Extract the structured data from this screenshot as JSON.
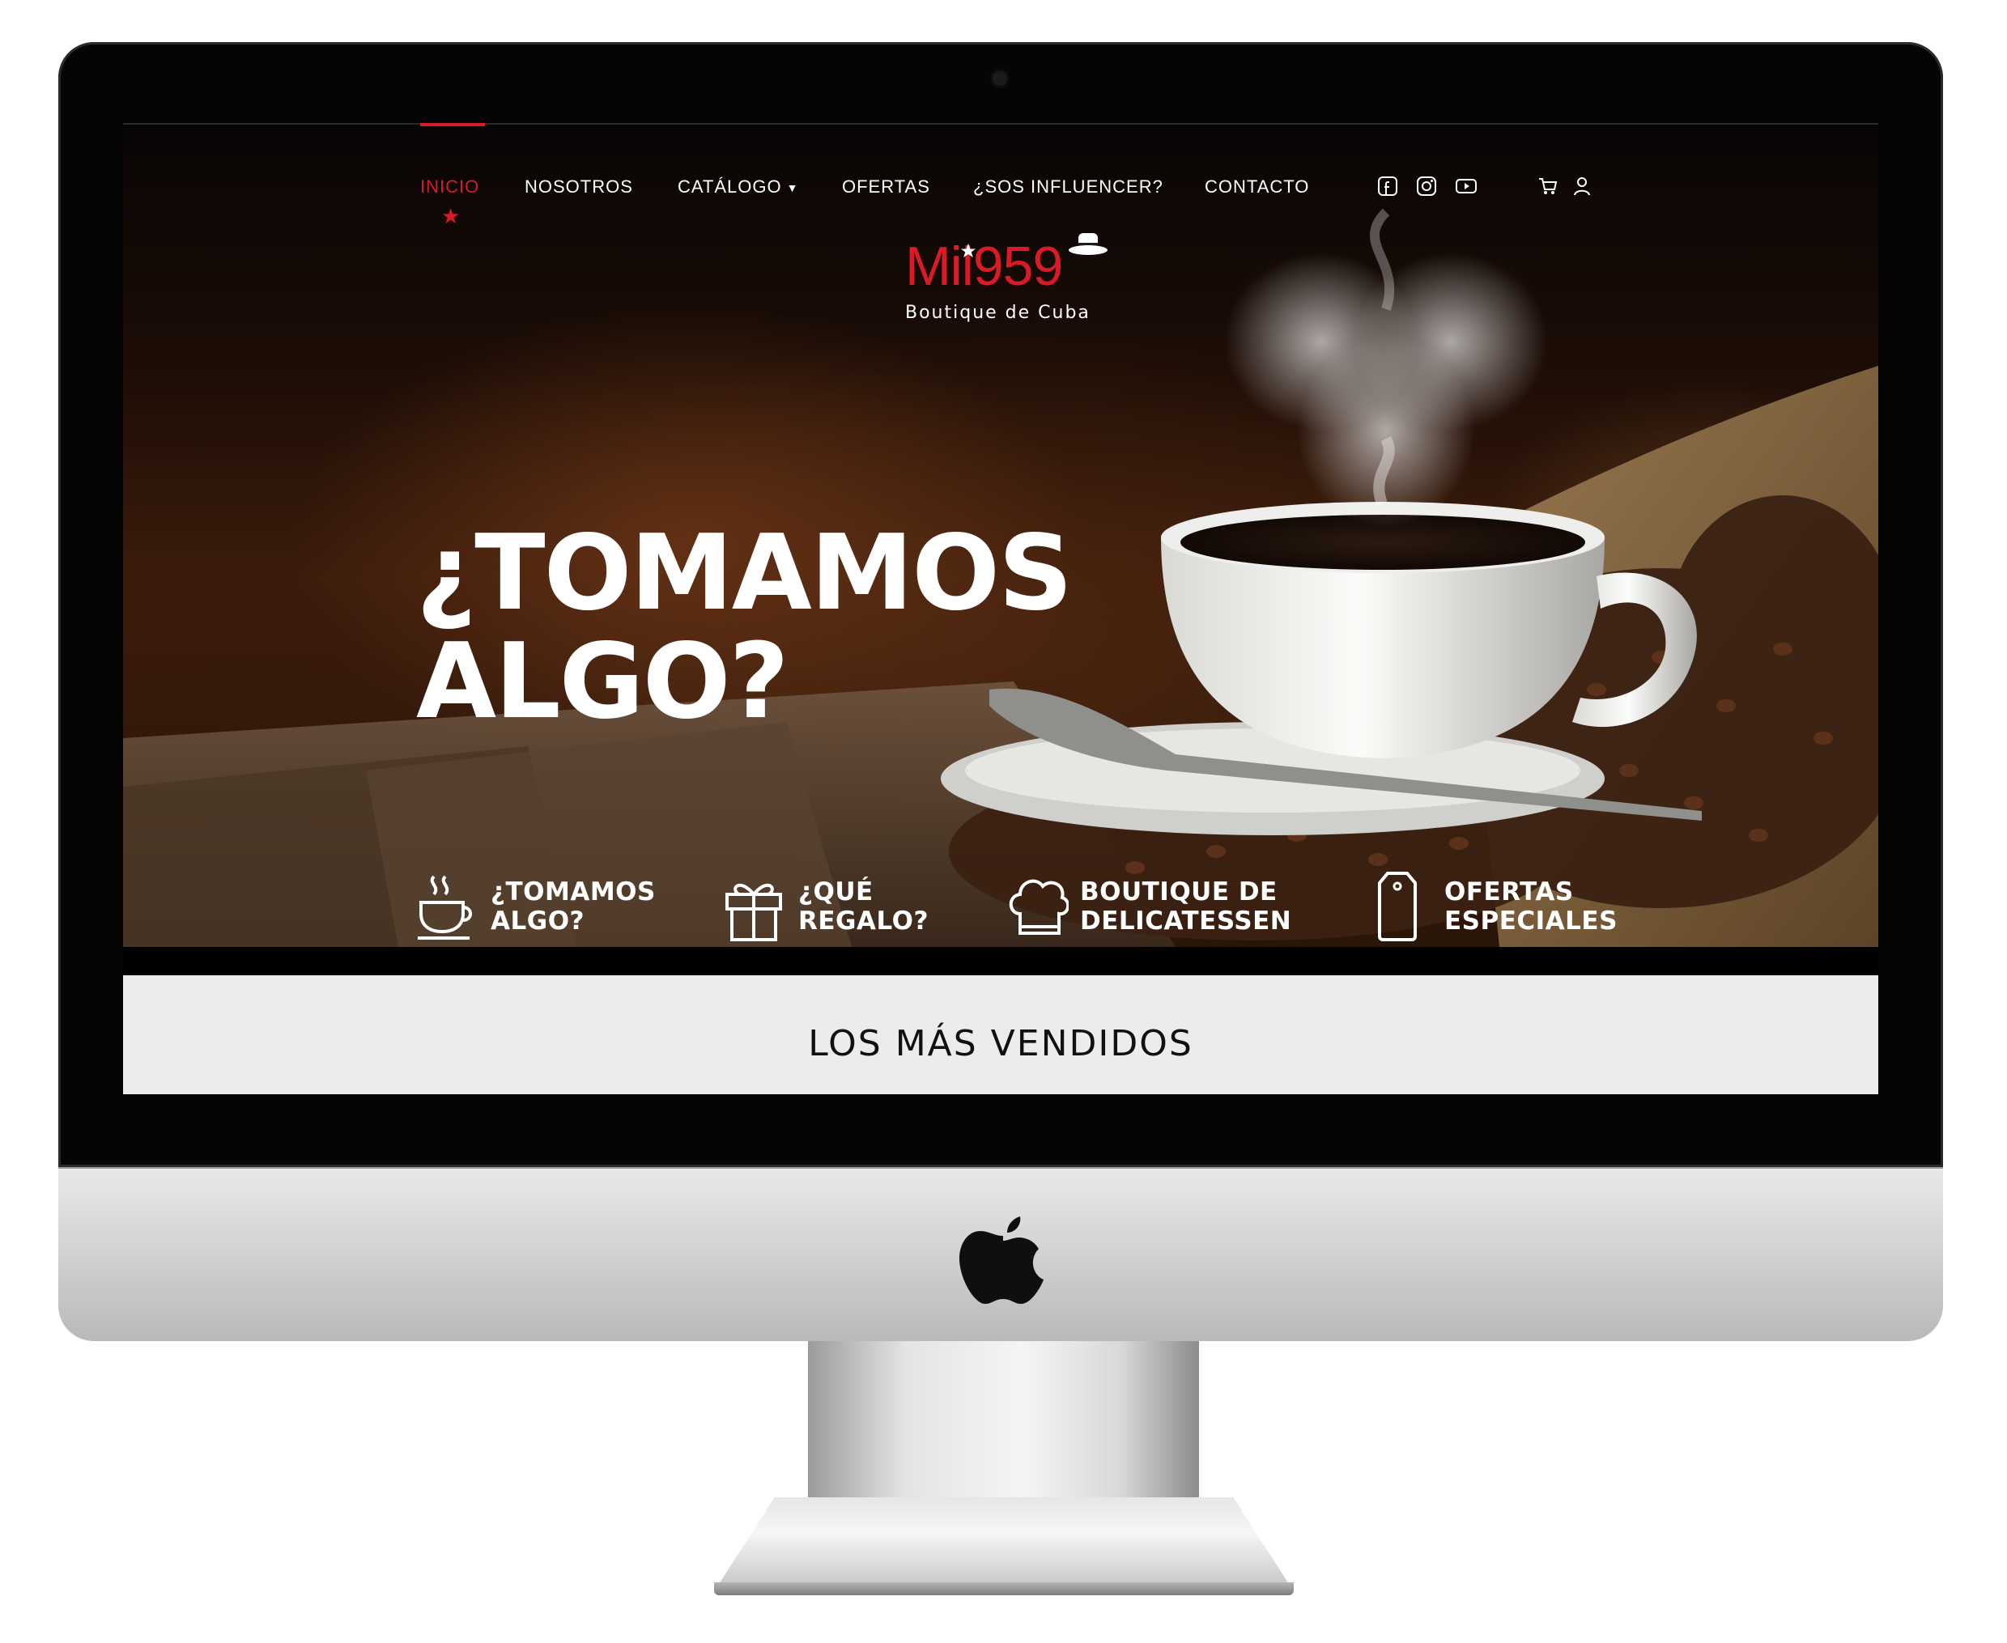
{
  "nav": {
    "items": [
      {
        "label": "INICIO",
        "active": true
      },
      {
        "label": "NOSOTROS"
      },
      {
        "label": "CATÁLOGO",
        "has_dropdown": true
      },
      {
        "label": "OFERTAS"
      },
      {
        "label": "¿SOS INFLUENCER?"
      },
      {
        "label": "CONTACTO"
      }
    ],
    "social_icons": [
      "facebook-icon",
      "instagram-icon",
      "youtube-icon"
    ],
    "utility_icons": [
      "cart-icon",
      "user-icon"
    ]
  },
  "logo": {
    "word": "Mil959",
    "tagline": "Boutique de Cuba"
  },
  "hero": {
    "headline_line1": "¿TOMAMOS",
    "headline_line2": "ALGO?"
  },
  "categories": [
    {
      "icon": "coffee-cup-icon",
      "line1": "¿TOMAMOS",
      "line2": "ALGO?"
    },
    {
      "icon": "gift-icon",
      "line1": "¿QUÉ",
      "line2": "REGALO?"
    },
    {
      "icon": "chef-hat-icon",
      "line1": "BOUTIQUE DE",
      "line2": "DELICATESSEN"
    },
    {
      "icon": "price-tag-icon",
      "line1": "OFERTAS",
      "line2": "ESPECIALES"
    }
  ],
  "section": {
    "title": "LOS MÁS VENDIDOS"
  },
  "colors": {
    "accent": "#d91b27",
    "brand_blue": "#1f5fb4",
    "screen_bg": "#000000",
    "section_band": "#ececec"
  }
}
